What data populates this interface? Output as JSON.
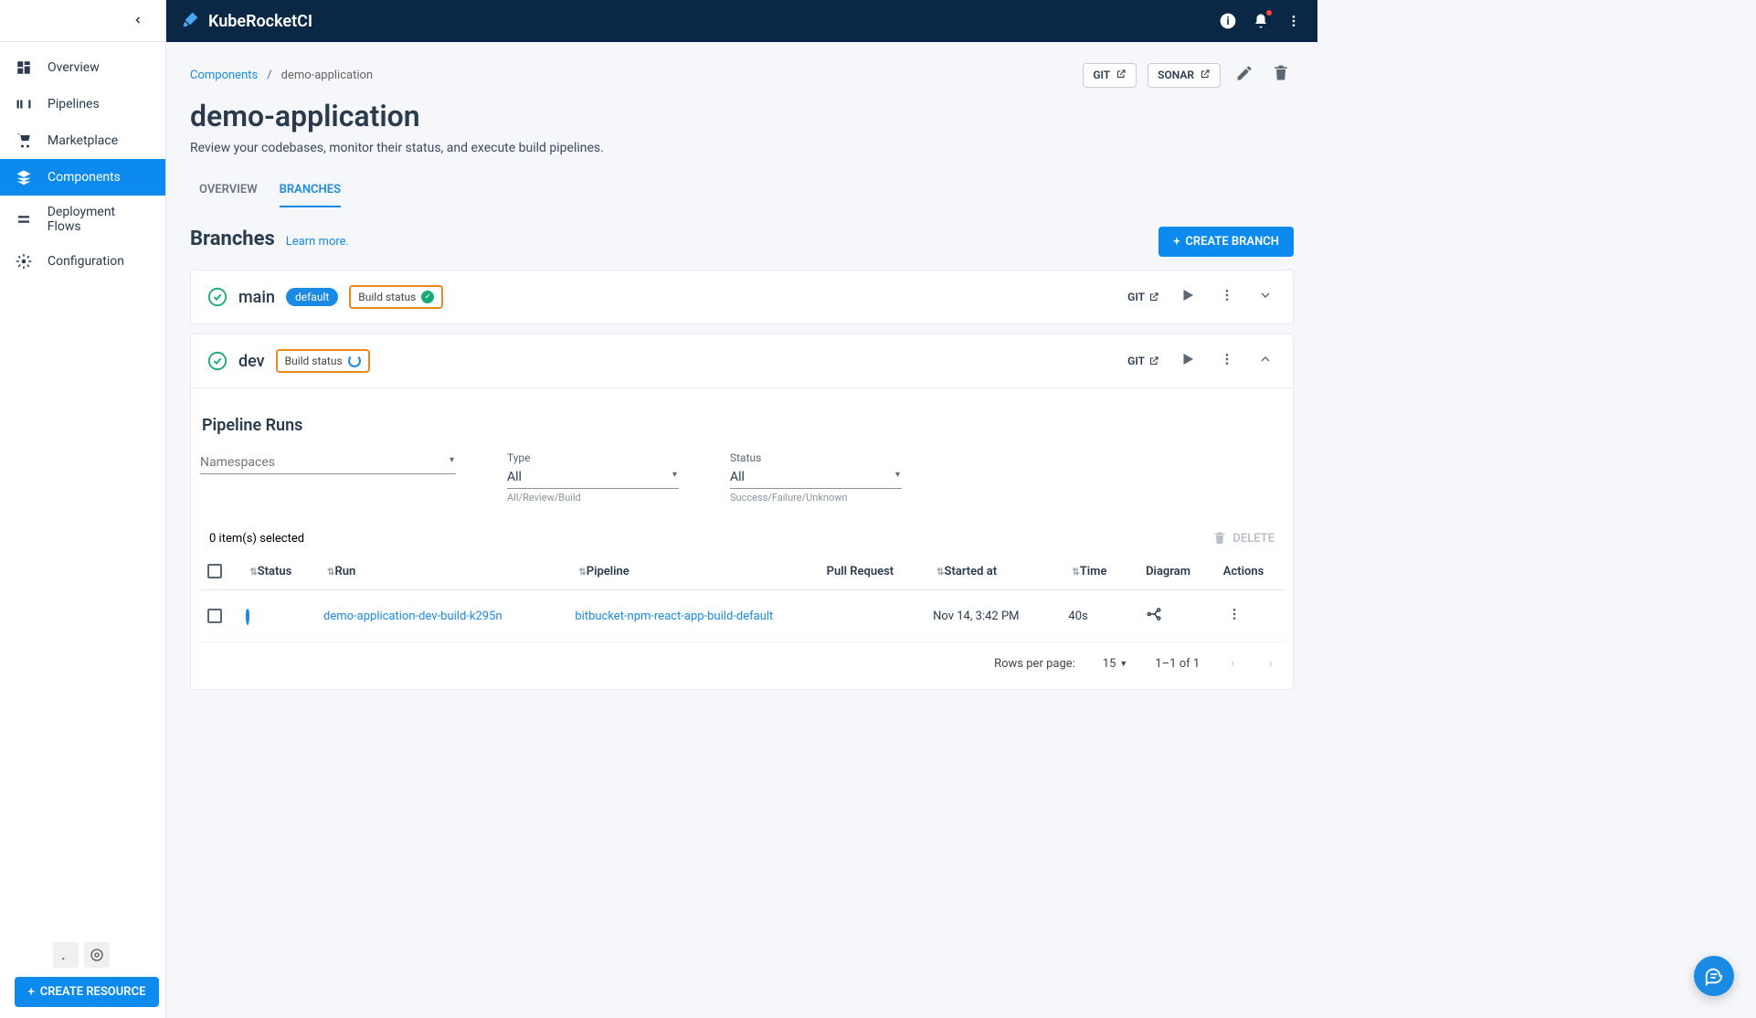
{
  "brand": "KubeRocketCI",
  "sidebar": {
    "items": [
      {
        "label": "Overview"
      },
      {
        "label": "Pipelines"
      },
      {
        "label": "Marketplace"
      },
      {
        "label": "Components"
      },
      {
        "label": "Deployment Flows"
      },
      {
        "label": "Configuration"
      }
    ],
    "create_button": "CREATE RESOURCE"
  },
  "breadcrumb": {
    "root": "Components",
    "current": "demo-application"
  },
  "page_actions": {
    "git": "GIT",
    "sonar": "SONAR"
  },
  "title": "demo-application",
  "description": "Review your codebases, monitor their status, and execute build pipelines.",
  "tabs": [
    {
      "label": "OVERVIEW"
    },
    {
      "label": "BRANCHES"
    }
  ],
  "section": {
    "title": "Branches",
    "learn_more": "Learn more.",
    "create_button": "CREATE BRANCH"
  },
  "branches": [
    {
      "name": "main",
      "default_badge": "default",
      "build_status_label": "Build status",
      "build_status": "success",
      "git": "GIT"
    },
    {
      "name": "dev",
      "build_status_label": "Build status",
      "build_status": "running",
      "git": "GIT"
    }
  ],
  "pipeline_runs": {
    "title": "Pipeline Runs",
    "filters": {
      "namespaces_label": "Namespaces",
      "type_label": "Type",
      "type_value": "All",
      "type_hint": "All/Review/Build",
      "status_label": "Status",
      "status_value": "All",
      "status_hint": "Success/Failure/Unknown"
    },
    "selected_text": "0 item(s) selected",
    "delete_label": "DELETE",
    "columns": {
      "status": "Status",
      "run": "Run",
      "pipeline": "Pipeline",
      "pull_request": "Pull Request",
      "started_at": "Started at",
      "time": "Time",
      "diagram": "Diagram",
      "actions": "Actions"
    },
    "rows": [
      {
        "status": "running",
        "run": "demo-application-dev-build-k295n",
        "pipeline": "bitbucket-npm-react-app-build-default",
        "pull_request": "",
        "started_at": "Nov 14, 3:42 PM",
        "time": "40s"
      }
    ],
    "pagination": {
      "rows_label": "Rows per page:",
      "rows_value": "15",
      "range": "1–1 of 1"
    }
  }
}
